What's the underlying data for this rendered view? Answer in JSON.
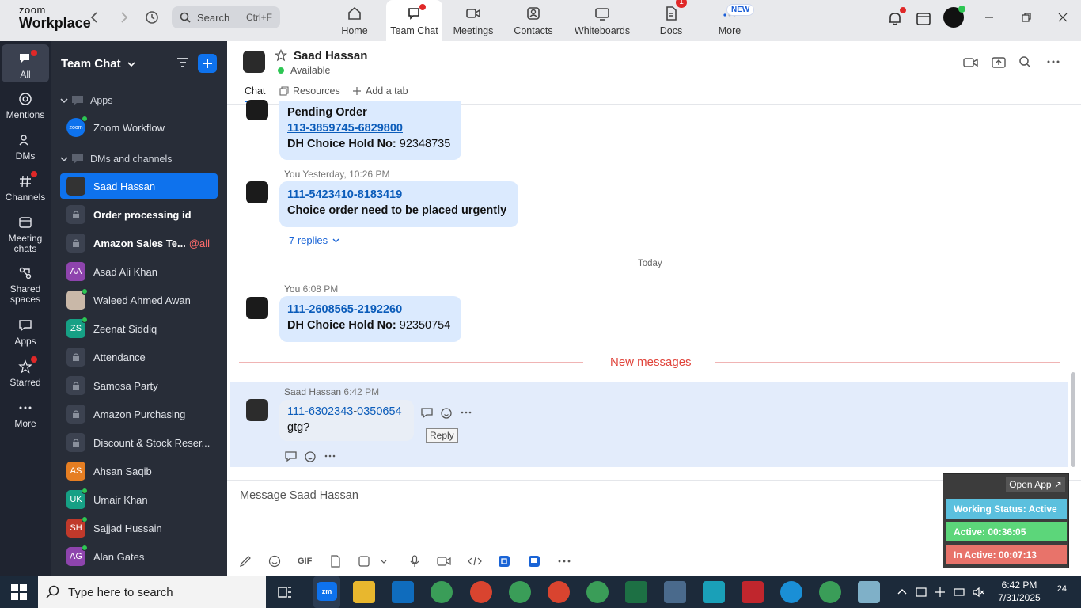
{
  "app": {
    "logo_line1": "zoom",
    "logo_line2": "Workplace"
  },
  "search": {
    "label": "Search",
    "shortcut": "Ctrl+F"
  },
  "tabs": [
    {
      "label": "Home",
      "icon": "home-icon"
    },
    {
      "label": "Team Chat",
      "icon": "chat-icon"
    },
    {
      "label": "Meetings",
      "icon": "video-icon"
    },
    {
      "label": "Contacts",
      "icon": "contacts-icon"
    },
    {
      "label": "Whiteboards",
      "icon": "whiteboard-icon"
    },
    {
      "label": "Docs",
      "icon": "docs-icon",
      "badge": "1"
    },
    {
      "label": "More",
      "icon": "more-icon",
      "badge": "NEW"
    }
  ],
  "rail": [
    {
      "label": "All"
    },
    {
      "label": "Mentions"
    },
    {
      "label": "DMs"
    },
    {
      "label": "Channels"
    },
    {
      "label": "Meeting chats"
    },
    {
      "label": "Shared spaces"
    },
    {
      "label": "Apps"
    },
    {
      "label": "Starred"
    },
    {
      "label": "More"
    }
  ],
  "sidebar": {
    "title": "Team Chat",
    "sections": {
      "apps": "Apps",
      "dms": "DMs and channels"
    },
    "items": [
      {
        "label": "Zoom Workflow",
        "avatar": "zoom"
      },
      {
        "label": "Saad Hassan"
      },
      {
        "label": "Order processing id"
      },
      {
        "label": "Amazon Sales Te...",
        "mention": "@all"
      },
      {
        "label": "Asad Ali Khan",
        "initials": "AA",
        "color": "#8e44ad"
      },
      {
        "label": "Waleed Ahmed Awan"
      },
      {
        "label": "Zeenat Siddiq",
        "initials": "ZS",
        "color": "#16a085"
      },
      {
        "label": "Attendance"
      },
      {
        "label": "Samosa Party"
      },
      {
        "label": "Amazon Purchasing"
      },
      {
        "label": "Discount & Stock Reser..."
      },
      {
        "label": "Ahsan Saqib",
        "initials": "AS",
        "color": "#e67e22"
      },
      {
        "label": "Umair Khan",
        "initials": "UK",
        "color": "#16a085"
      },
      {
        "label": "Sajjad Hussain",
        "initials": "SH",
        "color": "#c0392b"
      },
      {
        "label": "Alan Gates",
        "initials": "AG",
        "color": "#8e44ad"
      }
    ]
  },
  "chat": {
    "name": "Saad Hassan",
    "status": "Available",
    "tabs": {
      "chat": "Chat",
      "resources": "Resources",
      "add": "Add a tab"
    },
    "msg1": {
      "line1": "Pending Order",
      "link": "113-3859745-6829800",
      "label": "DH Choice Hold No:",
      "value": "92348735"
    },
    "msg2": {
      "sender": "You",
      "time": "Yesterday, 10:26 PM",
      "link": "111-5423410-8183419",
      "text": "Choice order need to be placed urgently",
      "replies": "7 replies"
    },
    "divider_today": "Today",
    "msg3": {
      "sender": "You",
      "time": "6:08 PM",
      "link": "111-2608565-2192260",
      "label": "DH Choice Hold No:",
      "value": "92350754"
    },
    "new_messages": "New messages",
    "msg4": {
      "sender": "Saad Hassan",
      "time": "6:42 PM",
      "link_a": "111-6302343",
      "sep": "-",
      "link_b": "0350654",
      "text": "gtg?",
      "tooltip": "Reply"
    },
    "composer_placeholder": "Message Saad Hassan",
    "gif": "GIF"
  },
  "widget": {
    "open": "Open App ↗",
    "working": "Working Status: Active",
    "active": "Active: 00:36:05",
    "inactive": "In Active: 00:07:13",
    "colors": {
      "working": "#5bc0de",
      "active": "#5cd67a",
      "inactive": "#e8736a"
    }
  },
  "taskbar": {
    "search": "Type here to search",
    "time": "6:42 PM",
    "date": "7/31/2025",
    "notif": "24"
  }
}
